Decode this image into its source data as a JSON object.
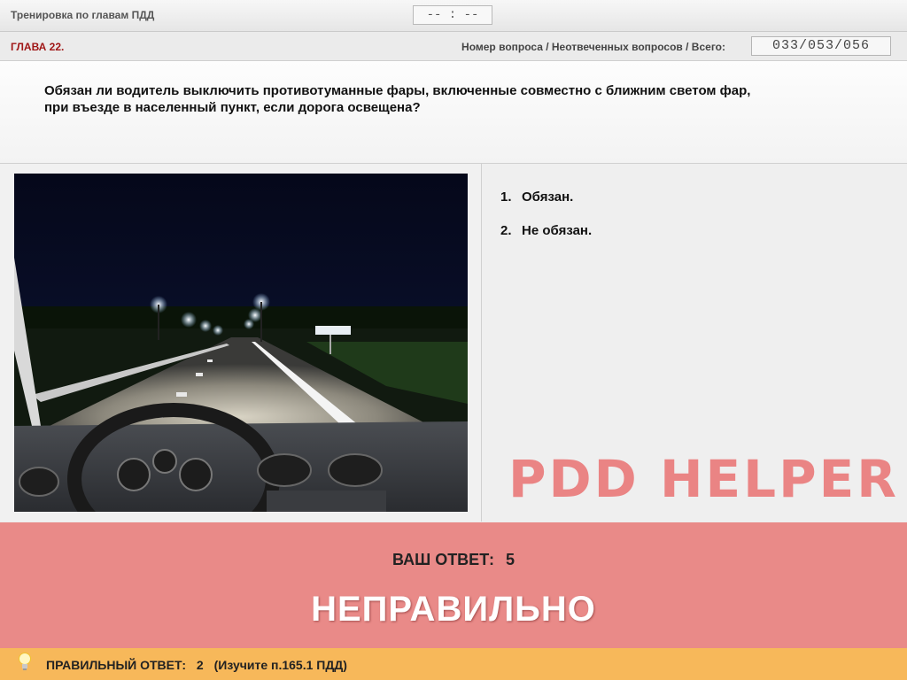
{
  "app": {
    "title": "Тренировка по главам ПДД",
    "timer": "-- : --"
  },
  "chapter": {
    "label": "ГЛАВА 22.",
    "counter_label": "Номер вопроса / Неотвеченных вопросов / Всего:",
    "counter_value": "033/053/056"
  },
  "question": {
    "text": "Обязан ли водитель выключить противотуманные фары, включенные совместно с ближним светом фар, при въезде в населенный пункт, если дорога освещена?"
  },
  "answers": [
    {
      "num": "1.",
      "text": "Обязан."
    },
    {
      "num": "2.",
      "text": "Не обязан."
    }
  ],
  "watermark": "PDD HELPER",
  "result": {
    "your_answer_label": "ВАШ ОТВЕТ:",
    "your_answer_value": "5",
    "verdict": "НЕПРАВИЛЬНО"
  },
  "correct": {
    "label": "ПРАВИЛЬНЫЙ ОТВЕТ:",
    "value": "2",
    "hint": "(Изучите п.165.1 ПДД)"
  },
  "colors": {
    "chapter": "#a01717",
    "result_bg": "#e98a88",
    "correct_bg": "#f7b85a",
    "watermark": "#ea8484"
  }
}
